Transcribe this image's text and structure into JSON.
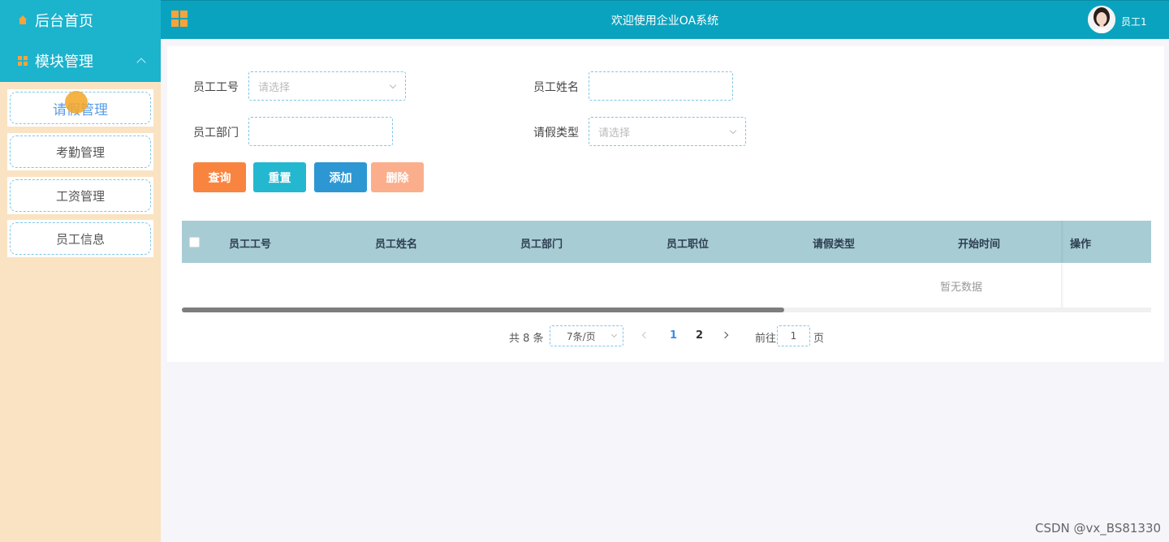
{
  "sidebar": {
    "home_label": "后台首页",
    "module_label": "模块管理",
    "items": [
      {
        "label": "请假管理"
      },
      {
        "label": "考勤管理"
      },
      {
        "label": "工资管理"
      },
      {
        "label": "员工信息"
      }
    ]
  },
  "header": {
    "title": "欢迎使用企业OA系统",
    "user": "员工1"
  },
  "filters": {
    "emp_no_label": "员工工号",
    "emp_no_placeholder": "请选择",
    "emp_name_label": "员工姓名",
    "emp_name_value": "",
    "dept_label": "员工部门",
    "dept_value": "",
    "leave_type_label": "请假类型",
    "leave_type_placeholder": "请选择"
  },
  "buttons": {
    "query": "查询",
    "reset": "重置",
    "add": "添加",
    "delete": "删除"
  },
  "colors": {
    "query": "#f9843f",
    "reset": "#23b8d0",
    "add": "#2d97d3",
    "delete": "#fbae8c"
  },
  "table": {
    "columns": [
      "员工工号",
      "员工姓名",
      "员工部门",
      "员工职位",
      "请假类型",
      "开始时间",
      "操作"
    ],
    "empty_text": "暂无数据"
  },
  "pagination": {
    "total_text": "共 8 条",
    "page_size": "7条/页",
    "pages": [
      "1",
      "2"
    ],
    "current_page": "1",
    "goto_label": "前往",
    "goto_value": "1",
    "page_suffix": "页"
  },
  "watermark": "CSDN @vx_BS81330"
}
